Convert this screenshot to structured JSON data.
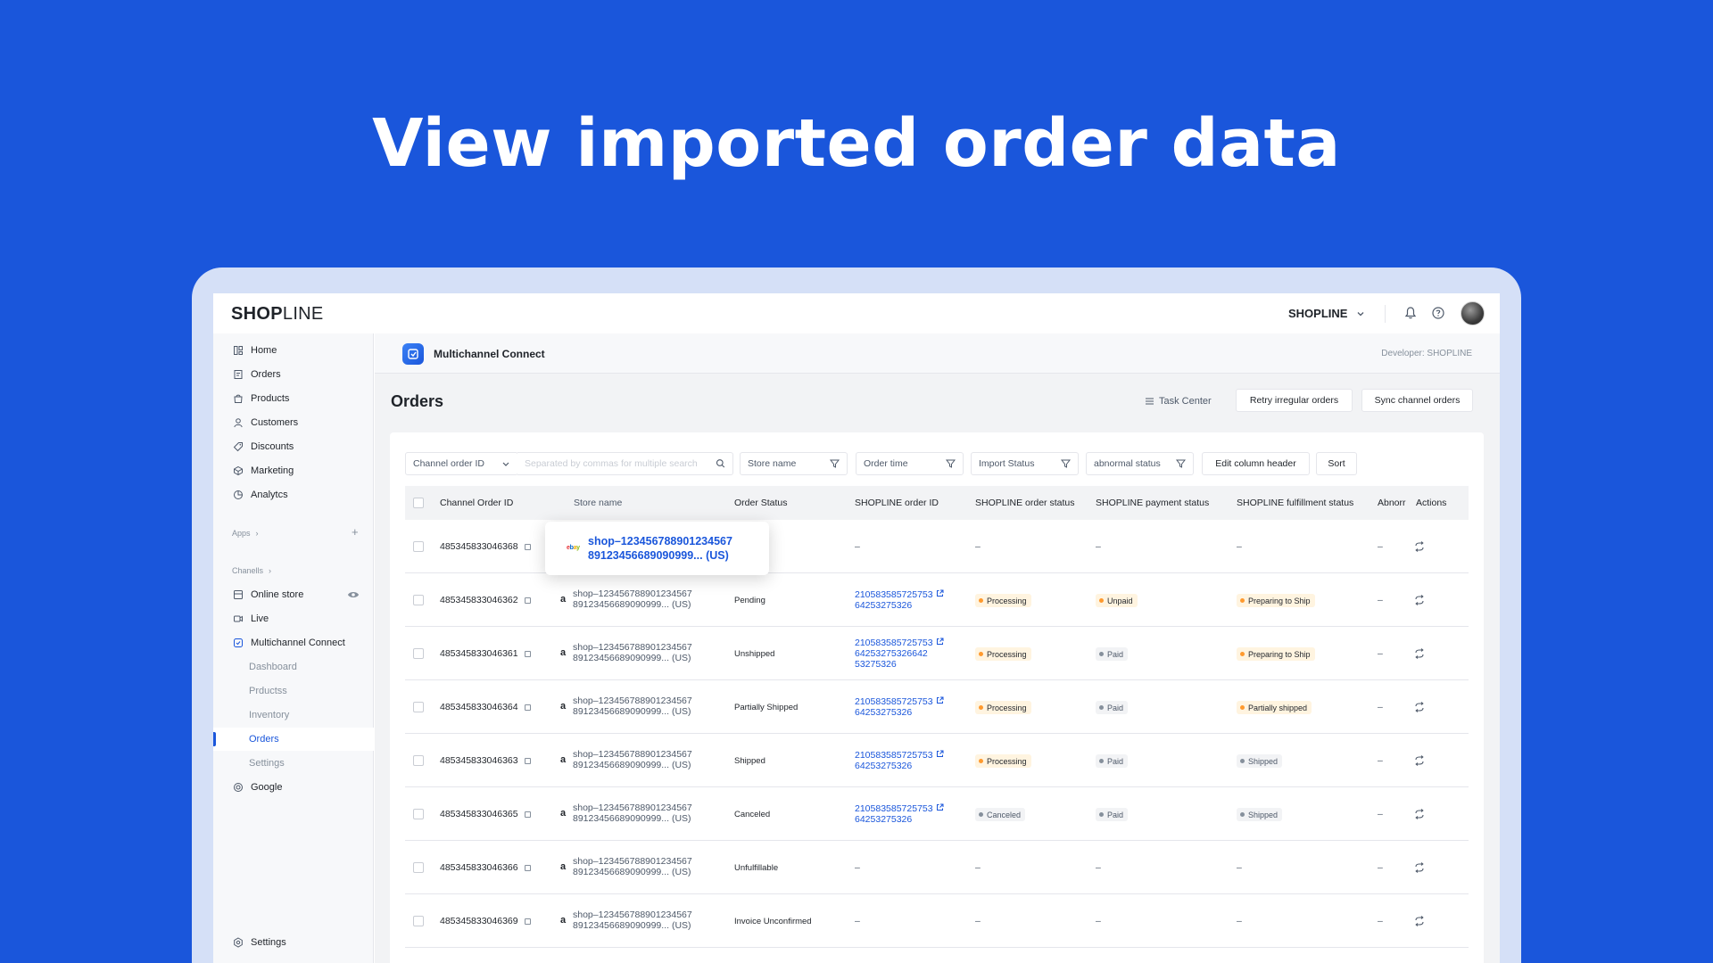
{
  "headline": "View imported order data",
  "topbar": {
    "logo_bold": "SHOP",
    "logo_rest": "LINE",
    "store_name": "SHOPLINE",
    "icons": [
      "bell-icon",
      "help-icon",
      "avatar"
    ]
  },
  "sidebar": {
    "items": [
      {
        "label": "Home",
        "icon": "home-icon"
      },
      {
        "label": "Orders",
        "icon": "orders-icon"
      },
      {
        "label": "Products",
        "icon": "products-icon"
      },
      {
        "label": "Customers",
        "icon": "customers-icon"
      },
      {
        "label": "Discounts",
        "icon": "discount-icon"
      },
      {
        "label": "Marketing",
        "icon": "marketing-icon"
      },
      {
        "label": "Analytcs",
        "icon": "analytics-icon"
      }
    ],
    "apps_label": "Apps",
    "channels_label": "Chanells",
    "channels": [
      {
        "label": "Online store",
        "icon": "store-icon"
      },
      {
        "label": "Live",
        "icon": "live-icon"
      },
      {
        "label": "Multichannel Connect",
        "icon": "multichannel-icon"
      }
    ],
    "sub_items": [
      "Dashboard",
      "Prductss",
      "Inventory",
      "Orders",
      "Settings"
    ],
    "active_sub": "Orders",
    "google": "Google",
    "settings": "Settings"
  },
  "appbar": {
    "title": "Multichannel Connect",
    "developer": "Developer: SHOPLINE"
  },
  "page": {
    "title": "Orders",
    "task_center": "Task Center",
    "retry_button": "Retry irregular orders",
    "sync_button": "Sync channel orders"
  },
  "filters": {
    "channel_select": "Channel order ID",
    "search_placeholder": "Separated by commas for multiple search",
    "store_name": "Store name",
    "order_time": "Order time",
    "import_status": "Import Status",
    "abnormal_status": "abnormal status",
    "edit_header": "Edit column header",
    "sort": "Sort"
  },
  "table": {
    "columns": [
      "Channel Order ID",
      "Store name",
      "Order Status",
      "SHOPLINE order ID",
      "SHOPLINE order status",
      "SHOPLINE payment status",
      "SHOPLINE fulfillment status",
      "Abnorr",
      "Actions"
    ],
    "rows": [
      {
        "channel_id": "485345833046368",
        "store_line1": "",
        "store_line2": "",
        "order_status": "",
        "sl_id_line1": "–",
        "sl_id_line2": "",
        "sl_id_line3": "",
        "sl_status": "–",
        "payment": "–",
        "fulfillment": "–",
        "abnormal": "–"
      },
      {
        "channel_id": "485345833046362",
        "store_line1": "shop–123456788901234567",
        "store_line2": "89123456689090999... (US)",
        "order_status": "Pending",
        "sl_id_line1": "210583585725753",
        "sl_id_line2": "64253275326",
        "sl_id_line3": "",
        "sl_status": "Processing",
        "payment": "Unpaid",
        "fulfillment": "Preparing to Ship",
        "abnormal": "–"
      },
      {
        "channel_id": "485345833046361",
        "store_line1": "shop–123456788901234567",
        "store_line2": "89123456689090999... (US)",
        "order_status": "Unshipped",
        "sl_id_line1": "210583585725753",
        "sl_id_line2": "64253275326642",
        "sl_id_line3": "53275326",
        "sl_status": "Processing",
        "payment": "Paid",
        "fulfillment": "Preparing to Ship",
        "abnormal": "–"
      },
      {
        "channel_id": "485345833046364",
        "store_line1": "shop–123456788901234567",
        "store_line2": "89123456689090999... (US)",
        "order_status": "Partially Shipped",
        "sl_id_line1": "210583585725753",
        "sl_id_line2": "64253275326",
        "sl_id_line3": "",
        "sl_status": "Processing",
        "payment": "Paid",
        "fulfillment": "Partially shipped",
        "abnormal": "–"
      },
      {
        "channel_id": "485345833046363",
        "store_line1": "shop–123456788901234567",
        "store_line2": "89123456689090999... (US)",
        "order_status": "Shipped",
        "sl_id_line1": "210583585725753",
        "sl_id_line2": "64253275326",
        "sl_id_line3": "",
        "sl_status": "Processing",
        "payment": "Paid",
        "fulfillment": "Shipped",
        "abnormal": "–"
      },
      {
        "channel_id": "485345833046365",
        "store_line1": "shop–123456788901234567",
        "store_line2": "89123456689090999... (US)",
        "order_status": "Canceled",
        "sl_id_line1": "210583585725753",
        "sl_id_line2": "64253275326",
        "sl_id_line3": "",
        "sl_status": "Canceled",
        "payment": "Paid",
        "fulfillment": "Shipped",
        "abnormal": "–"
      },
      {
        "channel_id": "485345833046366",
        "store_line1": "shop–123456788901234567",
        "store_line2": "89123456689090999... (US)",
        "order_status": "Unfulfillable",
        "sl_id_line1": "–",
        "sl_id_line2": "",
        "sl_id_line3": "",
        "sl_status": "–",
        "payment": "–",
        "fulfillment": "–",
        "abnormal": "–"
      },
      {
        "channel_id": "485345833046369",
        "store_line1": "shop–123456788901234567",
        "store_line2": "89123456689090999... (US)",
        "order_status": "Invoice Unconfirmed",
        "sl_id_line1": "–",
        "sl_id_line2": "",
        "sl_id_line3": "",
        "sl_status": "–",
        "payment": "–",
        "fulfillment": "–",
        "abnormal": "–"
      }
    ]
  },
  "popup": {
    "brand": "ebay",
    "line1": "shop–123456788901234567",
    "line2": "89123456689090999... (US)"
  },
  "colors": {
    "brand_blue": "#1a56db",
    "processing": "#ff9a2e",
    "neutral": "#86909c"
  }
}
